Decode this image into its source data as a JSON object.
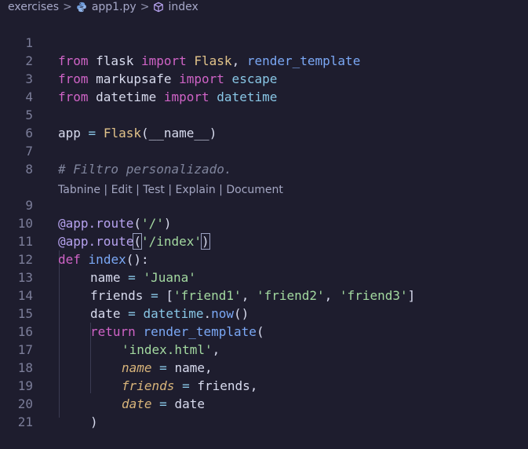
{
  "breadcrumb": {
    "folder": "exercises",
    "file": "app1.py",
    "symbol": "index",
    "separator": ">"
  },
  "codelens": "Tabnine | Edit | Test | Explain | Document",
  "line_numbers": [
    "1",
    "2",
    "3",
    "4",
    "5",
    "6",
    "7",
    "8",
    "9",
    "10",
    "11",
    "12",
    "13",
    "14",
    "15",
    "16",
    "17",
    "18",
    "19",
    "20",
    "21"
  ],
  "lines": {
    "l1": [
      "from",
      " flask ",
      "import",
      " Flask",
      ", ",
      "render_template"
    ],
    "l2": [
      "from",
      " markupsafe ",
      "import",
      " escape"
    ],
    "l3": [
      "from",
      " datetime ",
      "import",
      " datetime"
    ],
    "l5": [
      "app",
      " = ",
      "Flask",
      "(",
      "__name__",
      ")"
    ],
    "l7": [
      "# Filtro personalizado."
    ],
    "l9": [
      "@app",
      ".",
      "route",
      "(",
      "'/'",
      ")"
    ],
    "l10": [
      "@app",
      ".",
      "route",
      "(",
      "'/index'",
      ")"
    ],
    "l11": [
      "def",
      " ",
      "index",
      "():"
    ],
    "l12": [
      "name",
      " = ",
      "'Juana'"
    ],
    "l13": [
      "friends",
      " = ",
      "[",
      "'friend1'",
      ", ",
      "'friend2'",
      ", ",
      "'friend3'",
      "]"
    ],
    "l14": [
      "date",
      " = ",
      "datetime",
      ".",
      "now",
      "()"
    ],
    "l15": [
      "return",
      " ",
      "render_template",
      "("
    ],
    "l16": [
      "'index.html'",
      ","
    ],
    "l17": [
      "name",
      " = ",
      "name,"
    ],
    "l18": [
      "friends",
      " = ",
      "friends,"
    ],
    "l19": [
      "date",
      " = ",
      "date"
    ],
    "l20": [
      ")"
    ]
  }
}
